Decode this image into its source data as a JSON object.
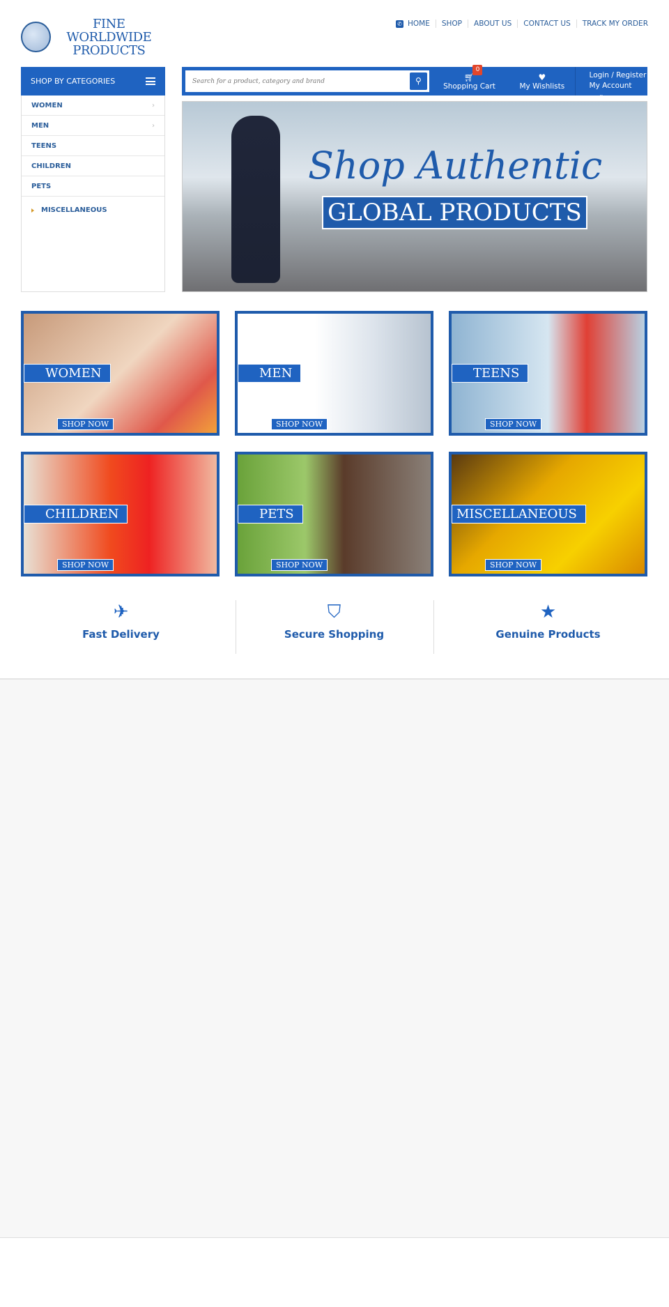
{
  "logo": {
    "text": "FINE WORLDWIDE PRODUCTS",
    "line1": "FINE WORLDWIDE",
    "line2": "PRODUCTS"
  },
  "topnav": {
    "icon": "phone-icon",
    "items": [
      "HOME",
      "SHOP",
      "ABOUT US",
      "CONTACT US",
      "TRACK MY ORDER"
    ]
  },
  "categories": {
    "title": "SHOP BY CATEGORIES",
    "items": [
      {
        "label": "WOMEN",
        "has_sub": true
      },
      {
        "label": "MEN",
        "has_sub": true
      },
      {
        "label": "TEENS"
      },
      {
        "label": "CHILDREN"
      },
      {
        "label": "PETS"
      }
    ],
    "misc": "MISCELLANEOUS"
  },
  "search": {
    "placeholder": "Search for a product, category and brand",
    "icon": "search-icon"
  },
  "cart": {
    "label": "Shopping Cart",
    "count": "0"
  },
  "wishlist": {
    "label": "My Wishlists"
  },
  "account": {
    "login": "Login / Register",
    "label": "My Account"
  },
  "banner": {
    "line1": "Shop Authentic",
    "line2": "GLOBAL PRODUCTS"
  },
  "tiles": [
    {
      "label": "WOMEN",
      "cta": "SHOP NOW"
    },
    {
      "label": "MEN",
      "cta": "SHOP NOW"
    },
    {
      "label": "TEENS",
      "cta": "SHOP NOW"
    },
    {
      "label": "CHILDREN",
      "cta": "SHOP NOW"
    },
    {
      "label": "PETS",
      "cta": "SHOP NOW"
    },
    {
      "label": "MISCELLANEOUS",
      "cta": "SHOP NOW"
    }
  ],
  "features": [
    {
      "icon": "airplane-icon",
      "label": "Fast Delivery"
    },
    {
      "icon": "shield-icon",
      "label": "Secure Shopping"
    },
    {
      "icon": "star-icon",
      "label": "Genuine Products"
    }
  ],
  "colors": {
    "primary": "#1f63c1",
    "text": "#2a5d9a",
    "badge": "#e2462b"
  }
}
